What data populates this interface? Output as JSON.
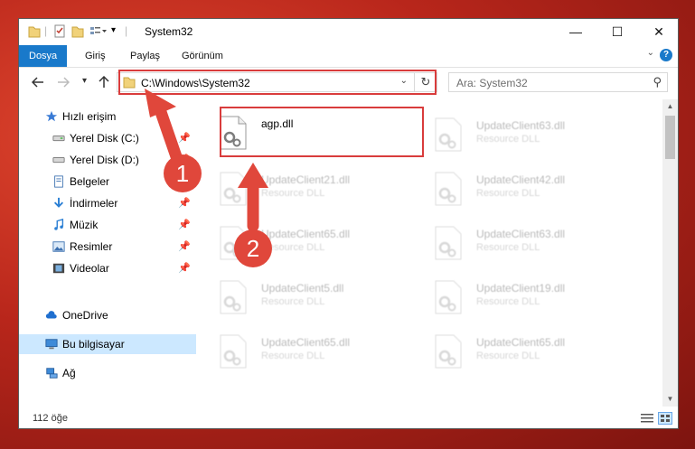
{
  "window": {
    "title": "System32",
    "minimize": "—",
    "maximize": "☐",
    "close": "✕"
  },
  "ribbon": {
    "tabs": [
      {
        "label": "Dosya",
        "active": true
      },
      {
        "label": "Giriş",
        "active": false
      },
      {
        "label": "Paylaş",
        "active": false
      },
      {
        "label": "Görünüm",
        "active": false
      }
    ],
    "help": "?"
  },
  "navigation": {
    "back_icon": "arrow-left-icon",
    "forward_icon": "arrow-right-icon",
    "recent_icon": "chevron-down-icon",
    "up_icon": "arrow-up-icon",
    "address": "C:\\Windows\\System32",
    "search_placeholder": "Ara: System32"
  },
  "sidebar": {
    "items": [
      {
        "label": "Hızlı erişim",
        "icon": "star-icon",
        "pinned": false,
        "indent": 0,
        "selected": false
      },
      {
        "label": "Yerel Disk (C:)",
        "icon": "drive-icon",
        "pinned": true,
        "indent": 1,
        "selected": false
      },
      {
        "label": "Yerel Disk (D:)",
        "icon": "drive-icon",
        "pinned": true,
        "indent": 1,
        "selected": false
      },
      {
        "label": "Belgeler",
        "icon": "documents-icon",
        "pinned": true,
        "indent": 1,
        "selected": false
      },
      {
        "label": "İndirmeler",
        "icon": "download-icon",
        "pinned": true,
        "indent": 1,
        "selected": false
      },
      {
        "label": "Müzik",
        "icon": "music-icon",
        "pinned": true,
        "indent": 1,
        "selected": false
      },
      {
        "label": "Resimler",
        "icon": "pictures-icon",
        "pinned": true,
        "indent": 1,
        "selected": false
      },
      {
        "label": "Videolar",
        "icon": "video-icon",
        "pinned": true,
        "indent": 1,
        "selected": false
      },
      {
        "label": "OneDrive",
        "icon": "cloud-icon",
        "pinned": false,
        "indent": 0,
        "selected": false
      },
      {
        "label": "Bu bilgisayar",
        "icon": "computer-icon",
        "pinned": false,
        "indent": 0,
        "selected": true
      },
      {
        "label": "Ağ",
        "icon": "network-icon",
        "pinned": false,
        "indent": 0,
        "selected": false
      }
    ]
  },
  "files": {
    "highlighted": {
      "name": "agp.dll",
      "type": ""
    },
    "faded": [
      {
        "name": "UpdateClient63.dll",
        "type": "Resource DLL"
      },
      {
        "name": "UpdateClient21.dll",
        "type": "Resource DLL"
      },
      {
        "name": "UpdateClient42.dll",
        "type": "Resource DLL"
      },
      {
        "name": "UpdateClient65.dll",
        "type": "Resource DLL"
      },
      {
        "name": "UpdateClient63.dll",
        "type": "Resource DLL"
      },
      {
        "name": "UpdateClient5.dll",
        "type": "Resource DLL"
      },
      {
        "name": "UpdateClient19.dll",
        "type": "Resource DLL"
      },
      {
        "name": "UpdateClient65.dll",
        "type": "Resource DLL"
      },
      {
        "name": "UpdateClient65.dll",
        "type": "Resource DLL"
      }
    ]
  },
  "status": {
    "item_count": "112 öğe"
  },
  "annotations": {
    "step1": "1",
    "step2": "2",
    "color": "#e0473b"
  }
}
